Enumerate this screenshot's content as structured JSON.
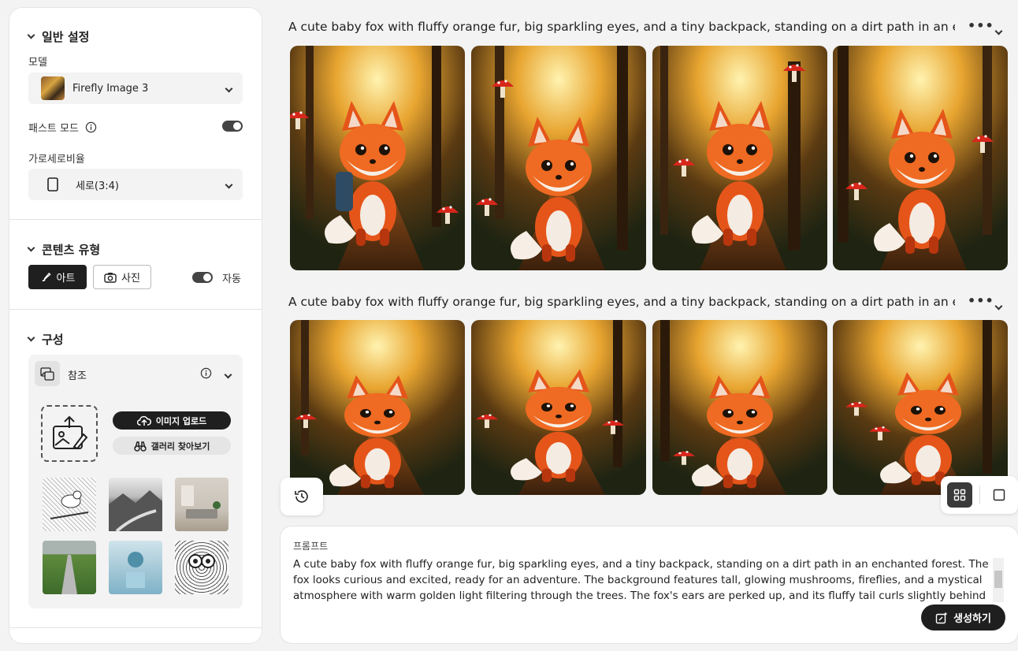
{
  "sidebar": {
    "general": {
      "title": "일반 설정",
      "model_label": "모델",
      "model_value": "Firefly Image 3",
      "fast_mode_label": "패스트 모드",
      "fast_mode_on": true,
      "aspect_label": "가로세로비율",
      "aspect_value": "세로(3:4)"
    },
    "content_type": {
      "title": "콘텐츠 유형",
      "art_label": "아트",
      "photo_label": "사진",
      "auto_label": "자동",
      "auto_on": true
    },
    "composition": {
      "title": "구성",
      "reference_label": "참조",
      "upload_label": "이미지 업로드",
      "gallery_label": "갤러리 찾아보기"
    }
  },
  "results": [
    {
      "prompt": "A cute baby fox with fluffy orange fur, big sparkling eyes, and a tiny backpack, standing on a dirt path in an enchant..."
    },
    {
      "prompt": "A cute baby fox with fluffy orange fur, big sparkling eyes, and a tiny backpack, standing on a dirt path in an enchant..."
    }
  ],
  "prompt_box": {
    "label": "프롬프트",
    "text": "A cute baby fox with fluffy orange fur, big sparkling eyes, and a tiny backpack, standing on a dirt path in an enchanted forest. The fox looks curious and excited, ready for an adventure. The background features tall, glowing mushrooms, fireflies, and a mystical atmosphere with warm golden light filtering through the trees. The fox's ears are perked up, and its fluffy tail curls slightly behind it, adding to its",
    "generate_label": "생성하기"
  }
}
